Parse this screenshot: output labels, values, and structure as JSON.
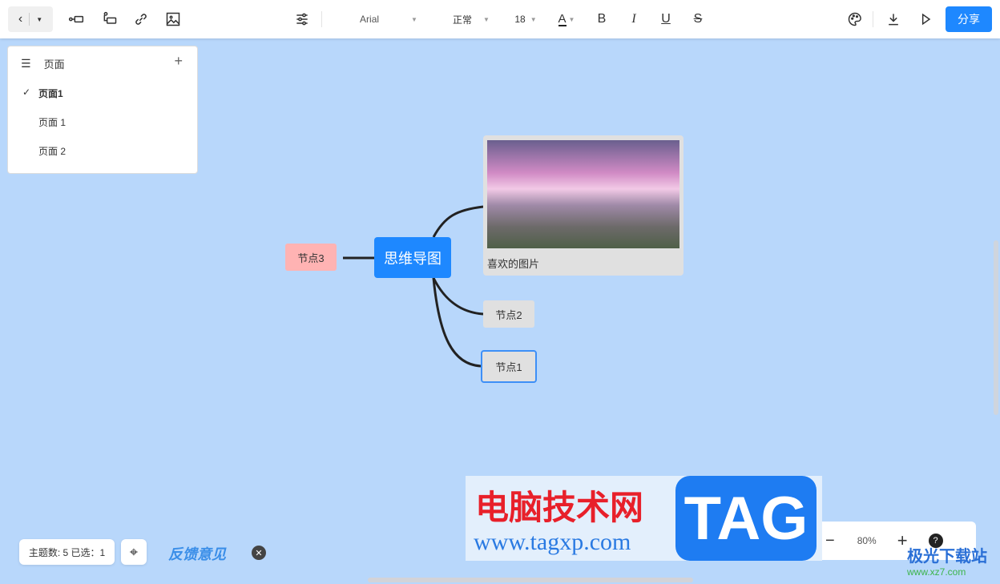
{
  "toolbar": {
    "font": "Arial",
    "style": "正常",
    "size": "18",
    "font_color_label": "A",
    "bold": "B",
    "italic": "I",
    "underline": "U",
    "strike": "S",
    "share": "分享"
  },
  "pages": {
    "title": "页面",
    "items": [
      {
        "label": "页面1",
        "active": true
      },
      {
        "label": "页面 1"
      },
      {
        "label": "页面 2"
      }
    ]
  },
  "mindmap": {
    "root": "思维导图",
    "nodes": [
      {
        "label": "喜欢的图片"
      },
      {
        "label": "节点2"
      },
      {
        "label": "节点1"
      },
      {
        "label": "节点3"
      }
    ]
  },
  "status": {
    "count": "主题数: 5 已选：1",
    "feedback": "反馈意见",
    "zoom": "80%",
    "help": "?"
  },
  "watermark": {
    "site": "电脑技术网",
    "url": "www.tagxp.com",
    "tag": "TAG",
    "corner": "极光下载站",
    "corner_url": "www.xz7.com"
  },
  "colors": {
    "canvas": "#b8d7fb",
    "accent": "#1e88ff",
    "node3": "#ffb3b3"
  }
}
